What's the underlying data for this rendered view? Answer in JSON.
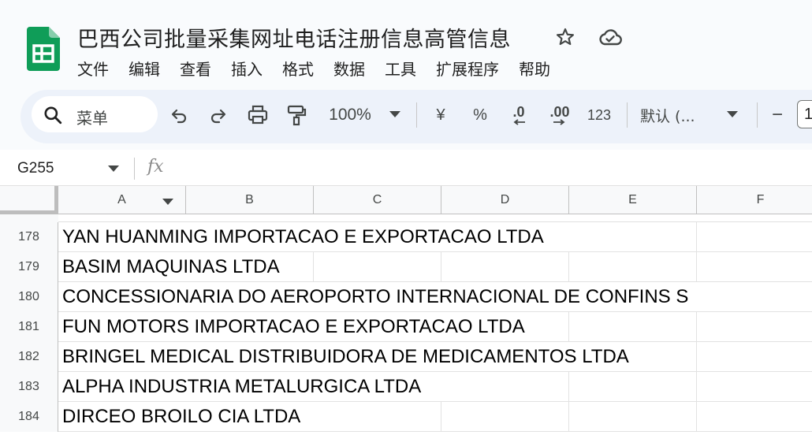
{
  "app": {
    "title": "巴西公司批量采集网址电话注册信息高管信息",
    "menu": [
      "文件",
      "编辑",
      "查看",
      "插入",
      "格式",
      "数据",
      "工具",
      "扩展程序",
      "帮助"
    ],
    "accent_color": "#0f9d58"
  },
  "toolbar": {
    "search_label": "菜单",
    "zoom": "100%",
    "currency": "¥",
    "percent": "%",
    "dec_decrease": ".0",
    "dec_increase": ".00",
    "number_format": "123",
    "font": "默认 (...",
    "font_size_minus": "−",
    "font_size": "1",
    "icons": [
      "search-icon",
      "undo-icon",
      "redo-icon",
      "print-icon",
      "paint-format-icon"
    ]
  },
  "formula_bar": {
    "cell_ref": "G255",
    "fx_label": "fx"
  },
  "grid": {
    "columns": [
      "A",
      "B",
      "C",
      "D",
      "E",
      "F"
    ],
    "rows": [
      {
        "num": "178",
        "a": "YAN HUANMING IMPORTACAO E EXPORTACAO LTDA"
      },
      {
        "num": "179",
        "a": "BASIM MAQUINAS LTDA"
      },
      {
        "num": "180",
        "a": "CONCESSIONARIA DO AEROPORTO INTERNACIONAL DE CONFINS S"
      },
      {
        "num": "181",
        "a": "FUN MOTORS IMPORTACAO E EXPORTACAO LTDA"
      },
      {
        "num": "182",
        "a": "BRINGEL MEDICAL DISTRIBUIDORA DE MEDICAMENTOS LTDA"
      },
      {
        "num": "183",
        "a": "ALPHA INDUSTRIA METALURGICA LTDA"
      },
      {
        "num": "184",
        "a": "DIRCEO BROILO CIA LTDA"
      }
    ]
  }
}
